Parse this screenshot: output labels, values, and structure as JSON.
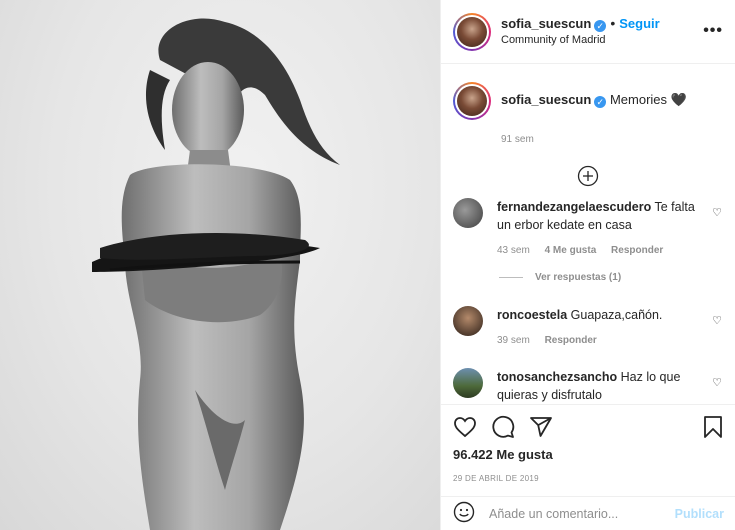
{
  "post": {
    "username": "sofia_suescun",
    "follow_label": "Seguir",
    "separator": "•",
    "location": "Community of Madrid",
    "more_label": "•••"
  },
  "caption": {
    "username": "sofia_suescun",
    "text": "Memories 🖤",
    "time": "91 sem"
  },
  "comments": [
    {
      "username": "fernandezangelaescudero",
      "text": "Te falta un erbor kedate en casa",
      "time": "43 sem",
      "likes": "4 Me gusta",
      "reply_label": "Responder"
    },
    {
      "username": "roncoestela",
      "text": "Guapaza,cañón.",
      "time": "39 sem",
      "reply_label": "Responder"
    },
    {
      "username": "tonosanchezsancho",
      "text": "Haz lo que quieras y disfrutalo"
    }
  ],
  "view_replies": "Ver respuestas (1)",
  "likes_count": "96.422 Me gusta",
  "date": "29 DE ABRIL DE 2019",
  "add_comment": {
    "placeholder": "Añade un comentario...",
    "publish_label": "Publicar"
  },
  "icons": {
    "like": "heart-icon",
    "comment": "comment-icon",
    "share": "share-icon",
    "save": "bookmark-icon",
    "emoji": "emoji-icon",
    "add_more": "plus-circle-icon",
    "verified": "verified-badge-icon"
  },
  "colors": {
    "accent": "#0095f6",
    "verified": "#3897f0",
    "muted": "#8e8e8e",
    "publish_disabled": "#b2dffc"
  }
}
